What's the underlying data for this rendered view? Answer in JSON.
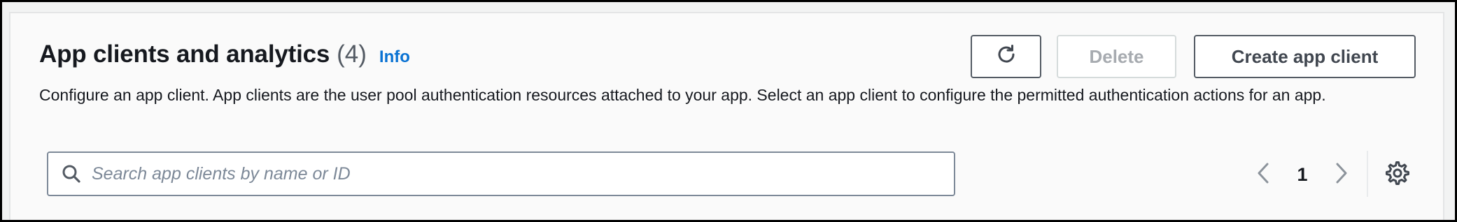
{
  "header": {
    "title": "App clients and analytics",
    "count": "(4)",
    "info_label": "Info",
    "description": "Configure an app client. App clients are the user pool authentication resources attached to your app. Select an app client to configure the permitted authentication actions for an app."
  },
  "actions": {
    "refresh_icon": "refresh-icon",
    "delete_label": "Delete",
    "delete_disabled": true,
    "create_label": "Create app client"
  },
  "search": {
    "icon": "search-icon",
    "value": "",
    "placeholder": "Search app clients by name or ID"
  },
  "pagination": {
    "prev_icon": "chevron-left-icon",
    "current_page": "1",
    "next_icon": "chevron-right-icon"
  },
  "preferences": {
    "icon": "gear-icon"
  },
  "colors": {
    "link": "#0972d3",
    "text": "#16191f",
    "muted": "#545b64",
    "disabled": "#a7abb0",
    "border": "#545b64"
  }
}
